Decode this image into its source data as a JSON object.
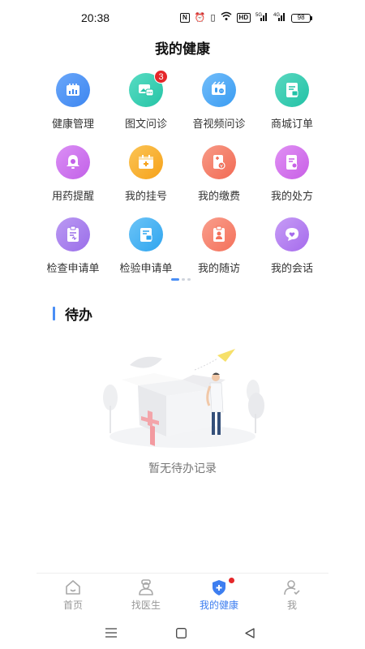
{
  "status_bar": {
    "time": "20:38",
    "nfc": "N",
    "hd": "HD",
    "signal1": "5G",
    "signal2": "4G",
    "battery": "98"
  },
  "page_title": "我的健康",
  "grid": [
    {
      "label": "健康管理",
      "icon": "health-management-icon",
      "color": "#3d86f0",
      "color2": "#6aa7fa"
    },
    {
      "label": "图文问诊",
      "icon": "image-text-consult-icon",
      "color": "#25c4a6",
      "color2": "#58dcc3",
      "badge": "3"
    },
    {
      "label": "音视频问诊",
      "icon": "video-consult-icon",
      "color": "#3a9cf2",
      "color2": "#72bdfa"
    },
    {
      "label": "商城订单",
      "icon": "mall-order-icon",
      "color": "#22c2a6",
      "color2": "#5ad8c0"
    },
    {
      "label": "用药提醒",
      "icon": "medication-reminder-icon",
      "color": "#c261e8",
      "color2": "#db8ff5"
    },
    {
      "label": "我的挂号",
      "icon": "registration-icon",
      "color": "#f6a21a",
      "color2": "#fbc455"
    },
    {
      "label": "我的缴费",
      "icon": "payment-icon",
      "color": "#f26a54",
      "color2": "#f79a86"
    },
    {
      "label": "我的处方",
      "icon": "prescription-icon",
      "color": "#c85fe6",
      "color2": "#e090f4"
    },
    {
      "label": "检查申请单",
      "icon": "exam-request-icon",
      "color": "#9a6ee9",
      "color2": "#bb9af3"
    },
    {
      "label": "检验申请单",
      "icon": "lab-request-icon",
      "color": "#2fa5ef",
      "color2": "#6cc4f7"
    },
    {
      "label": "我的随访",
      "icon": "follow-up-icon",
      "color": "#f4715b",
      "color2": "#f99e8c"
    },
    {
      "label": "我的会话",
      "icon": "conversation-icon",
      "color": "#a56bec",
      "color2": "#c79cf6"
    }
  ],
  "section": {
    "title": "待办"
  },
  "empty": {
    "text": "暂无待办记录"
  },
  "tabs": [
    {
      "label": "首页",
      "icon": "home-icon"
    },
    {
      "label": "找医生",
      "icon": "doctor-icon"
    },
    {
      "label": "我的健康",
      "icon": "health-shield-icon"
    },
    {
      "label": "我",
      "icon": "profile-icon"
    }
  ],
  "colors": {
    "accent": "#3d7ef0",
    "badge": "#e5272a",
    "inactive": "#999999"
  }
}
